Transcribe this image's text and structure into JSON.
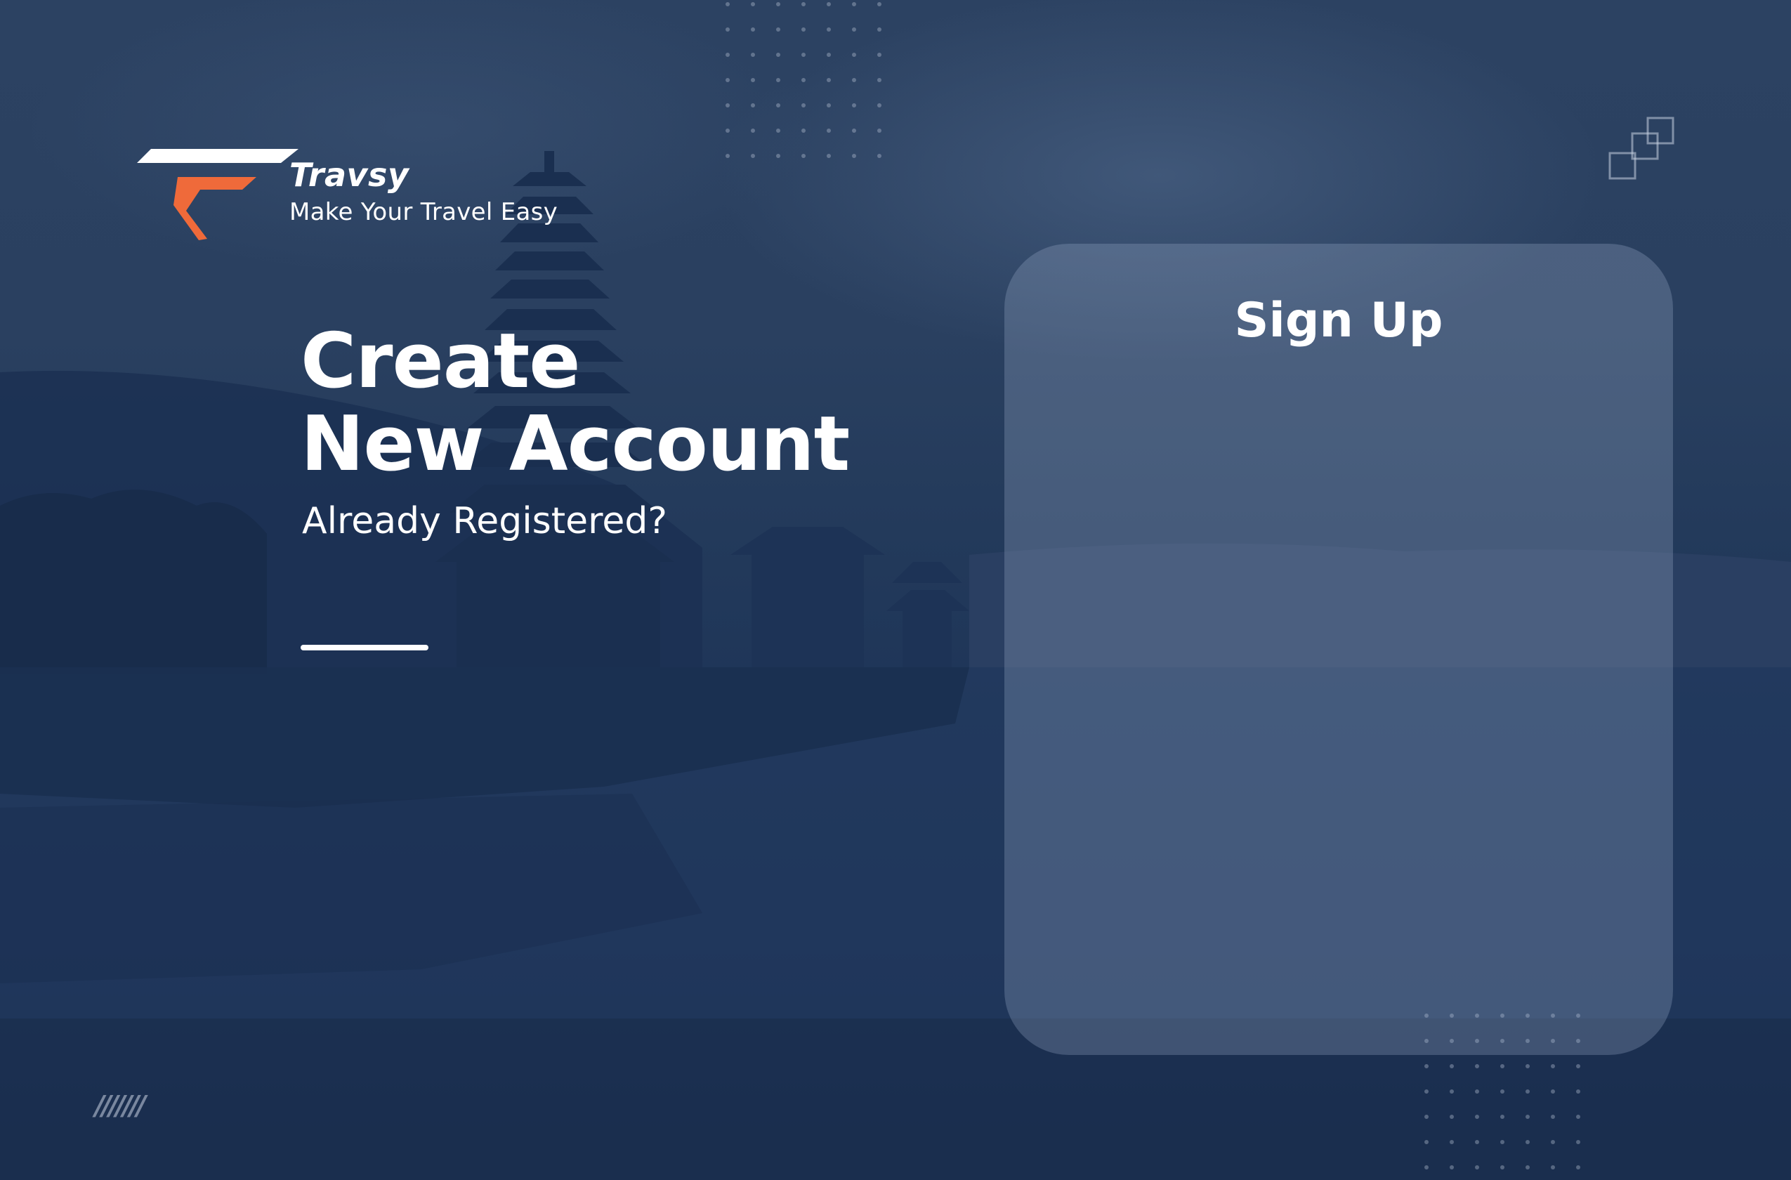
{
  "brand": {
    "name": "Travsy",
    "tagline": "Make Your Travel Easy",
    "logo_colors": {
      "primary": "#ffffff",
      "accent": "#ef6a3a"
    }
  },
  "hero": {
    "line1": "Create",
    "line2": "New Account",
    "login_link": "Already Registered?"
  },
  "signup_card": {
    "title": "Sign Up"
  },
  "decor": {
    "slashes": "///////"
  },
  "colors": {
    "background": "#1f3455",
    "text": "#ffffff",
    "accent": "#ef6a3a"
  }
}
